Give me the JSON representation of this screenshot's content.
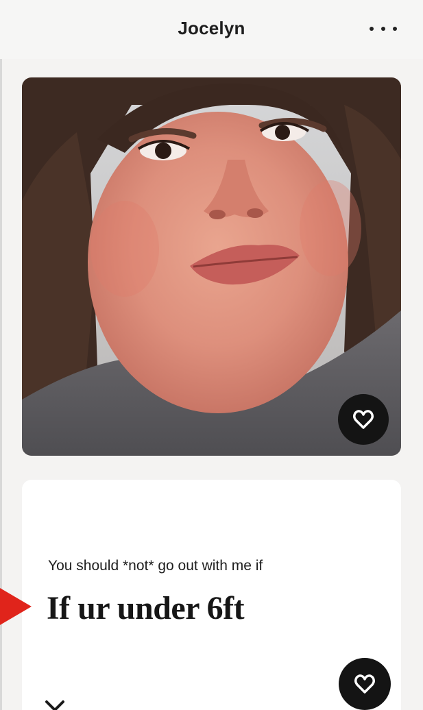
{
  "header": {
    "title": "Jocelyn",
    "more_icon": "more-horizontal-icon"
  },
  "photo": {
    "like_icon": "heart-icon"
  },
  "prompt": {
    "question": "You should *not* go out with me if",
    "answer": "If ur under 6ft",
    "like_icon": "heart-icon"
  },
  "actions": {
    "dismiss_icon": "close-icon"
  },
  "colors": {
    "like_button_bg": "#141414",
    "pointer_arrow": "#e0241b",
    "card_bg": "#ffffff",
    "page_bg": "#f4f3f2"
  }
}
